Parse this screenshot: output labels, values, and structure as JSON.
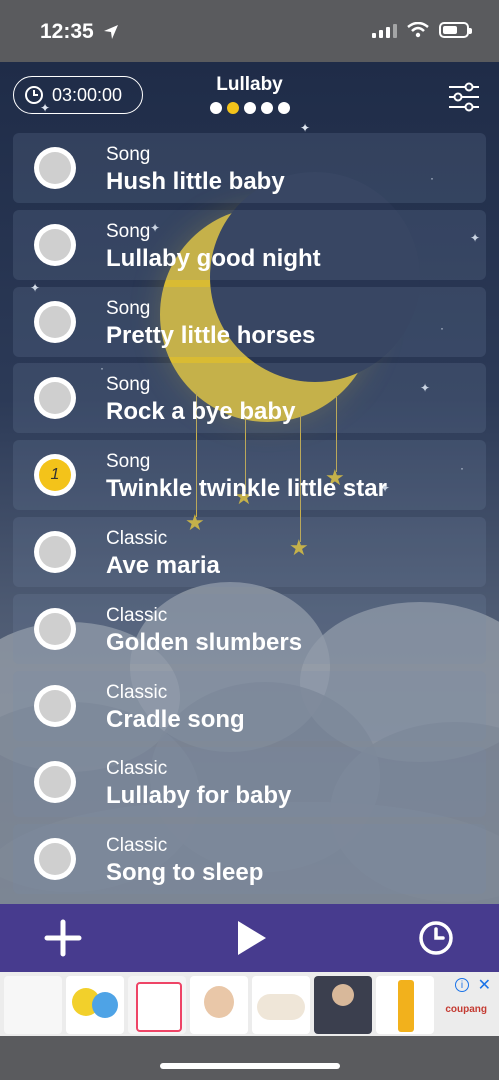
{
  "status_bar": {
    "time": "12:35"
  },
  "header": {
    "timer": "03:00:00",
    "title": "Lullaby"
  },
  "pager": {
    "count": 5,
    "active_index": 1
  },
  "songs": [
    {
      "category": "Song",
      "name": "Hush little baby",
      "selected": false,
      "badge": ""
    },
    {
      "category": "Song",
      "name": "Lullaby good night",
      "selected": false,
      "badge": ""
    },
    {
      "category": "Song",
      "name": "Pretty little horses",
      "selected": false,
      "badge": ""
    },
    {
      "category": "Song",
      "name": "Rock a bye baby",
      "selected": false,
      "badge": ""
    },
    {
      "category": "Song",
      "name": "Twinkle twinkle little star",
      "selected": true,
      "badge": "1"
    },
    {
      "category": "Classic",
      "name": "Ave maria",
      "selected": false,
      "badge": ""
    },
    {
      "category": "Classic",
      "name": "Golden slumbers",
      "selected": false,
      "badge": ""
    },
    {
      "category": "Classic",
      "name": "Cradle song",
      "selected": false,
      "badge": ""
    },
    {
      "category": "Classic",
      "name": "Lullaby for baby",
      "selected": false,
      "badge": ""
    },
    {
      "category": "Classic",
      "name": "Song to sleep",
      "selected": false,
      "badge": ""
    }
  ],
  "bottom_bar": {
    "add_icon": "plus-icon",
    "play_icon": "play-icon",
    "timer_icon": "clock-icon"
  },
  "ad": {
    "brand": "coupang"
  },
  "colors": {
    "accent": "#f3c31a",
    "bottom_bar": "#473b8e",
    "moon": "#d9bb33"
  }
}
